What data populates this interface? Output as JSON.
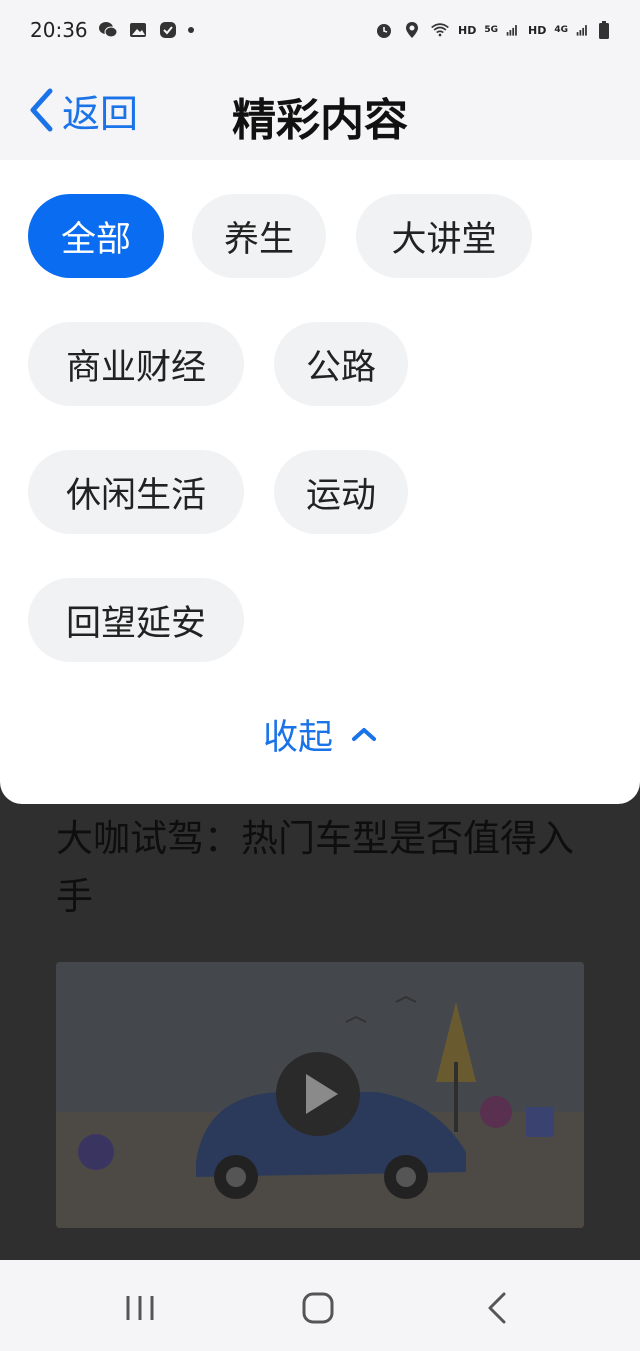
{
  "status_bar": {
    "time": "20:36",
    "hd1": "HD",
    "net1": "5G",
    "hd2": "HD",
    "net2": "4G",
    "icons": [
      "wechat-icon",
      "gallery-icon",
      "check-app-icon",
      "dot-icon",
      "alarm-icon",
      "location-icon",
      "wifi-icon",
      "signal-icon",
      "battery-icon"
    ]
  },
  "header": {
    "back_label": "返回",
    "title": "精彩内容"
  },
  "categories": {
    "items": [
      "全部",
      "养生",
      "大讲堂",
      "商业财经",
      "公路",
      "休闲生活",
      "运动",
      "回望延安"
    ],
    "active_index": 0,
    "collapse_label": "收起"
  },
  "article": {
    "title": "大咖试驾：热门车型是否值得入手"
  },
  "colors": {
    "accent": "#0a6cf0",
    "link": "#1a73e8",
    "chip_bg": "#f1f2f4",
    "overlay": "#2f2f2f"
  },
  "nav_bar": {
    "icons": [
      "recents-icon",
      "home-icon",
      "back-nav-icon"
    ]
  }
}
